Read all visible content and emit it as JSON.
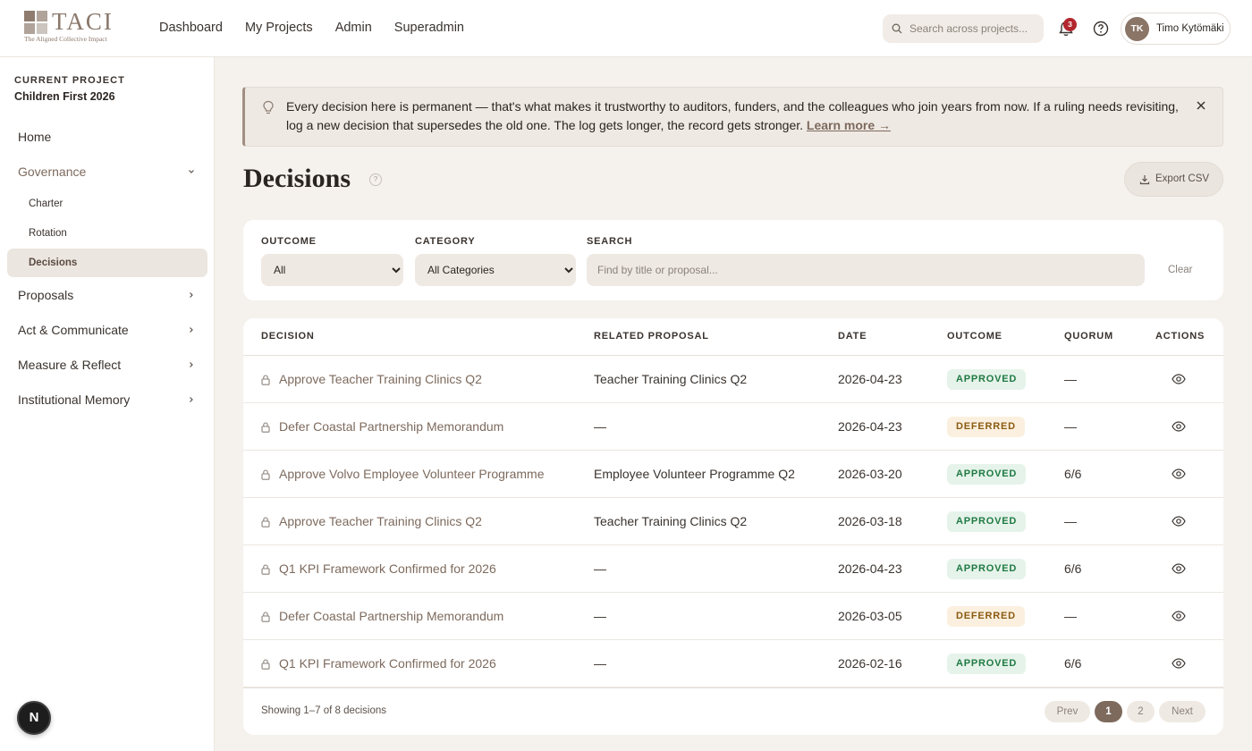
{
  "brand": {
    "name": "TACI",
    "tagline": "The Aligned Collective Impact"
  },
  "nav": {
    "items": [
      "Dashboard",
      "My Projects",
      "Admin",
      "Superadmin"
    ]
  },
  "search": {
    "placeholder": "Search across projects..."
  },
  "notifications": {
    "count": "3"
  },
  "user": {
    "initials": "TK",
    "name": "Timo Kytömäki"
  },
  "sidebar": {
    "current_project_label": "CURRENT PROJECT",
    "project_name": "Children First 2026",
    "items": [
      "Home",
      "Governance",
      "Proposals",
      "Act & Communicate",
      "Measure & Reflect",
      "Institutional Memory"
    ],
    "governance_children": [
      "Charter",
      "Rotation",
      "Decisions"
    ],
    "active": "Decisions"
  },
  "banner": {
    "text": "Every decision here is permanent — that's what makes it trustworthy to auditors, funders, and the colleagues who join years from now. If a ruling needs revisiting, log a new decision that supersedes the old one. The log gets longer, the record gets stronger.",
    "link": "Learn more →"
  },
  "page": {
    "title": "Decisions",
    "help": "?",
    "export_label": "Export CSV"
  },
  "filters": {
    "outcome_label": "OUTCOME",
    "outcome_value": "All",
    "category_label": "CATEGORY",
    "category_value": "All Categories",
    "search_label": "SEARCH",
    "search_placeholder": "Find by title or proposal...",
    "clear_label": "Clear"
  },
  "table": {
    "columns": [
      "DECISION",
      "RELATED PROPOSAL",
      "DATE",
      "OUTCOME",
      "QUORUM",
      "ACTIONS"
    ],
    "rows": [
      {
        "decision": "Approve Teacher Training Clinics Q2",
        "proposal": "Teacher Training Clinics Q2",
        "date": "2026-04-23",
        "outcome": "APPROVED",
        "quorum": "—"
      },
      {
        "decision": "Defer Coastal Partnership Memorandum",
        "proposal": "—",
        "date": "2026-04-23",
        "outcome": "DEFERRED",
        "quorum": "—"
      },
      {
        "decision": "Approve Volvo Employee Volunteer Programme",
        "proposal": "Employee Volunteer Programme Q2",
        "date": "2026-03-20",
        "outcome": "APPROVED",
        "quorum": "6/6"
      },
      {
        "decision": "Approve Teacher Training Clinics Q2",
        "proposal": "Teacher Training Clinics Q2",
        "date": "2026-03-18",
        "outcome": "APPROVED",
        "quorum": "—"
      },
      {
        "decision": "Q1 KPI Framework Confirmed for 2026",
        "proposal": "—",
        "date": "2026-04-23",
        "outcome": "APPROVED",
        "quorum": "6/6"
      },
      {
        "decision": "Defer Coastal Partnership Memorandum",
        "proposal": "—",
        "date": "2026-03-05",
        "outcome": "DEFERRED",
        "quorum": "—"
      },
      {
        "decision": "Q1 KPI Framework Confirmed for 2026",
        "proposal": "—",
        "date": "2026-02-16",
        "outcome": "APPROVED",
        "quorum": "6/6"
      }
    ],
    "footer": "Showing 1–7 of 8 decisions",
    "pagination": {
      "prev": "Prev",
      "pages": [
        "1",
        "2"
      ],
      "current": "1",
      "next": "Next"
    }
  },
  "dev_button": "N"
}
